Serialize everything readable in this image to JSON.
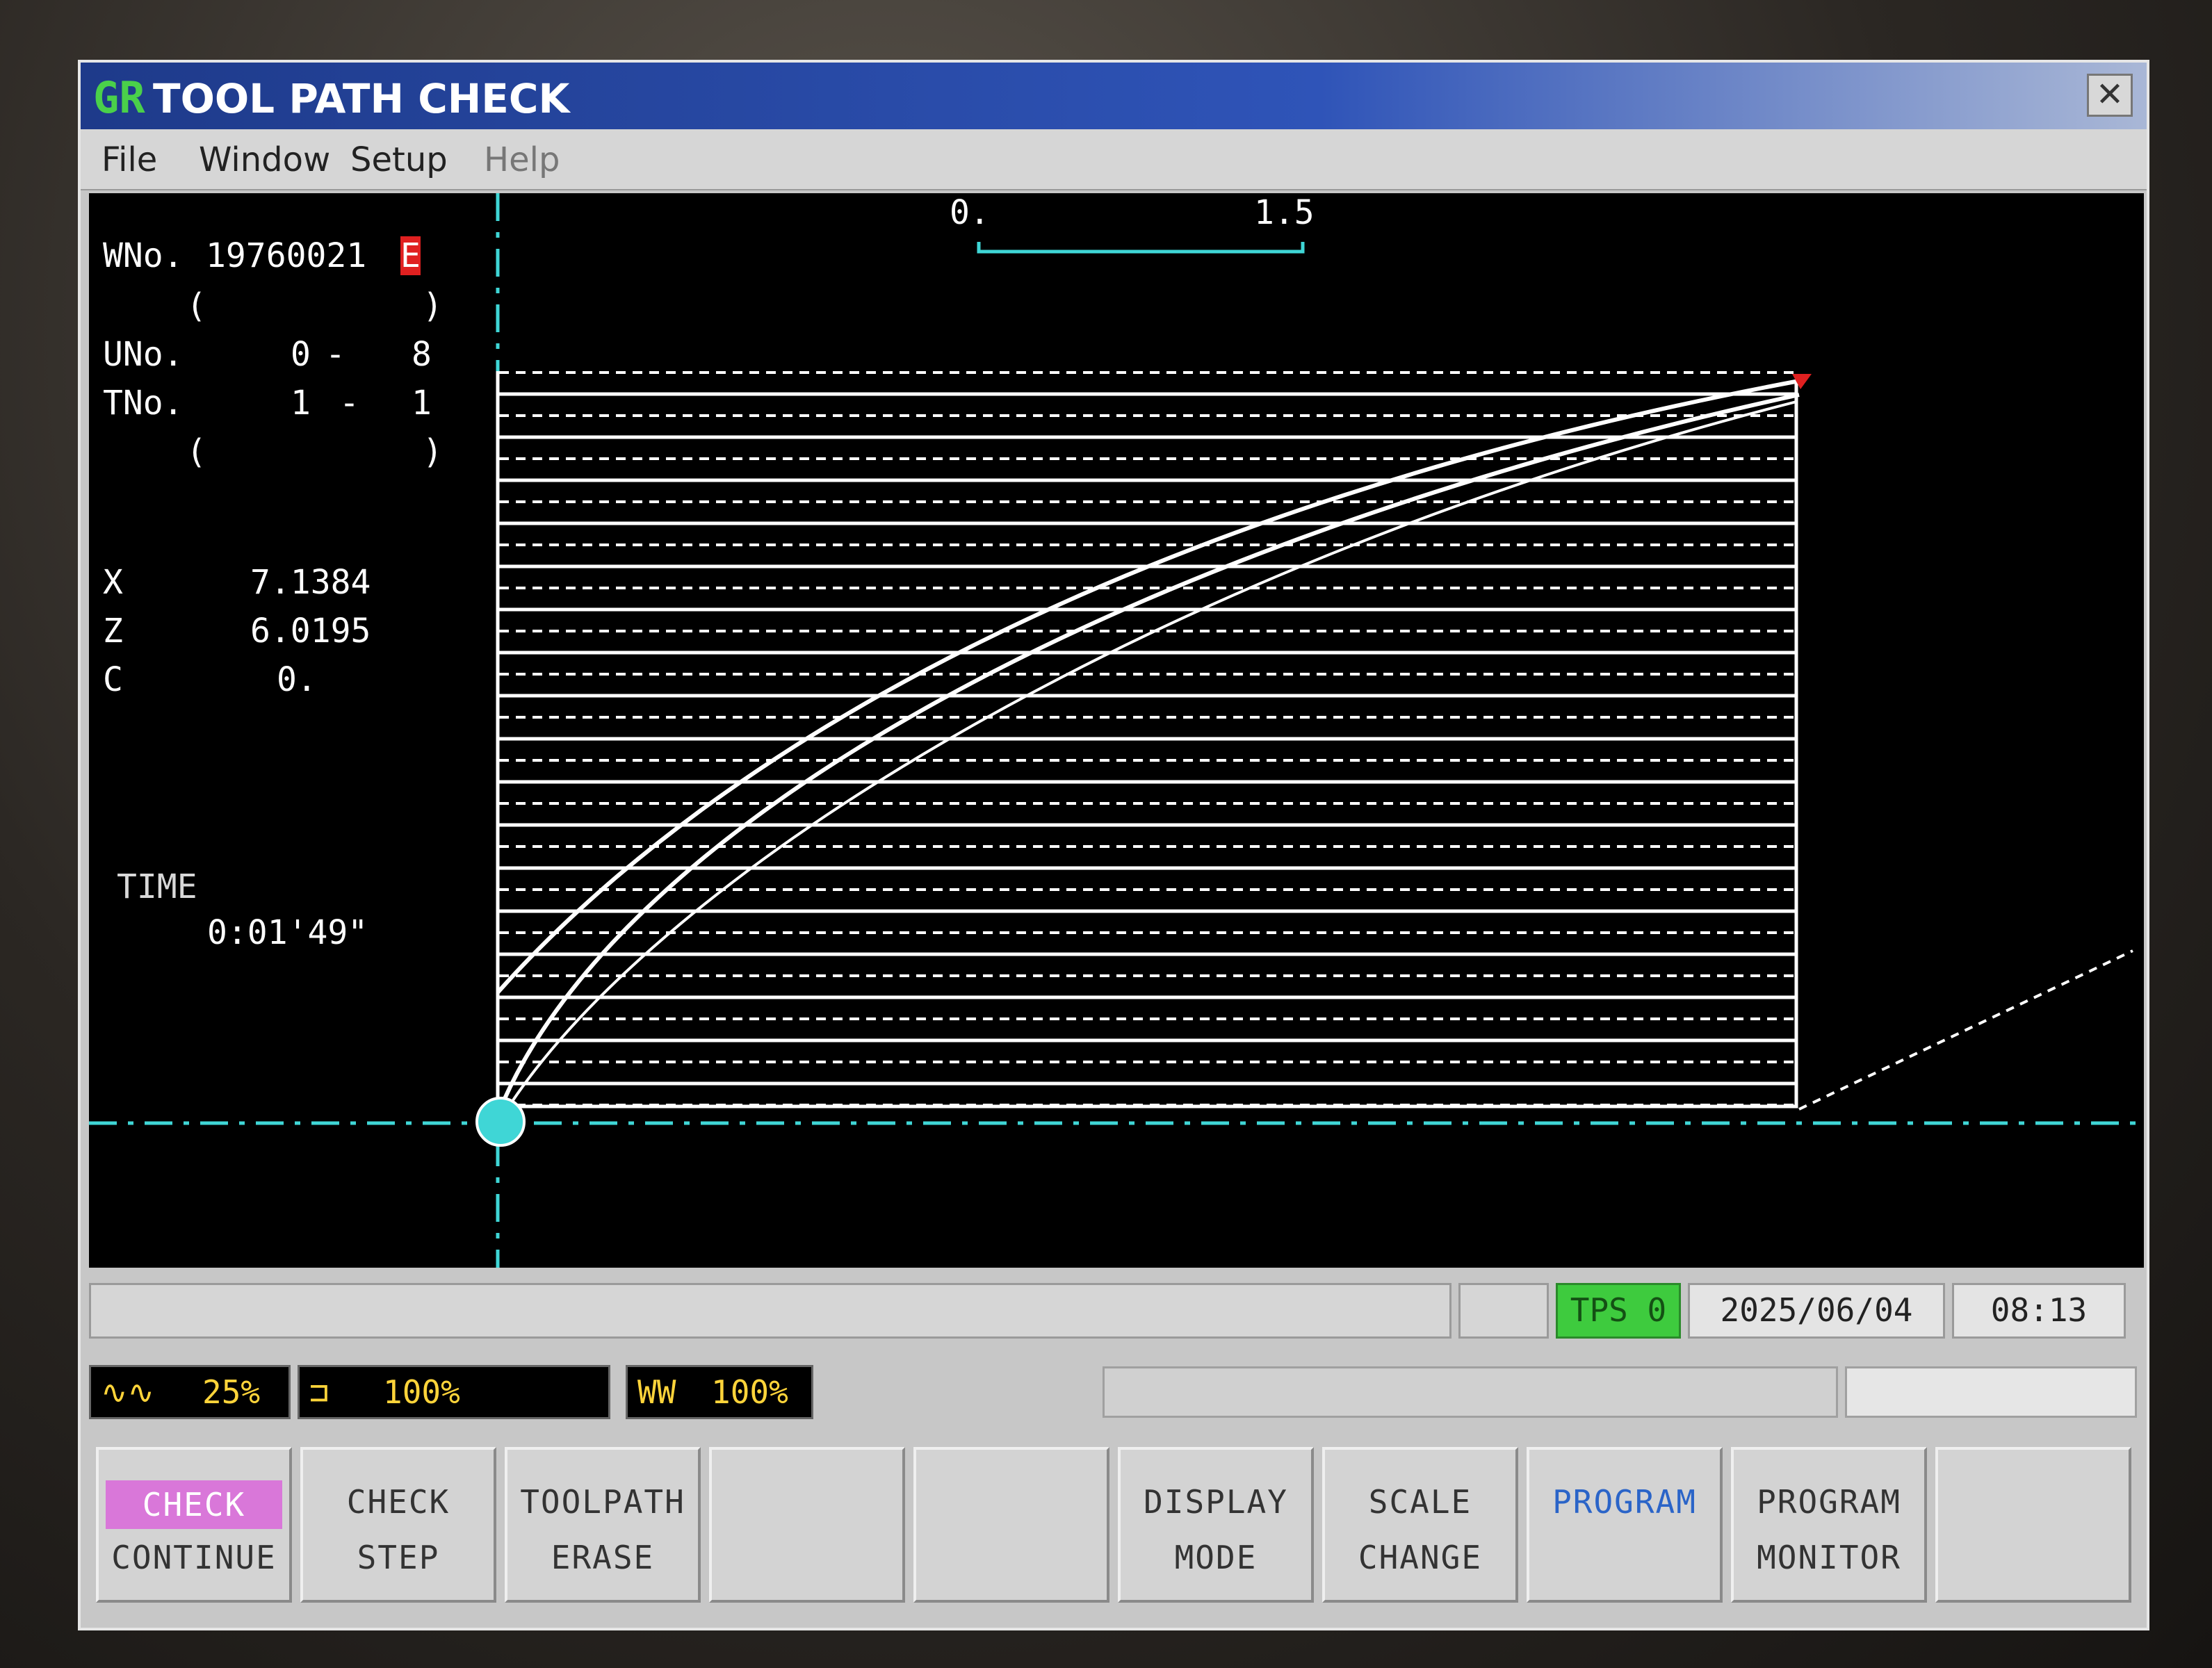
{
  "window": {
    "logo": "GR",
    "title": "TOOL PATH CHECK",
    "close_glyph": "✕",
    "menu": [
      "File",
      "Window",
      "Setup",
      "Help"
    ]
  },
  "info": {
    "wno_label": "WNo.",
    "wno_value": "19760021",
    "wno_suffix": "E",
    "paren1_open": "(",
    "paren1_close": ")",
    "uno_label": "UNo.",
    "uno_from": "0",
    "uno_sep": "-",
    "uno_to": "8",
    "tno_label": "TNo.",
    "tno_from": "1",
    "tno_sep": "-",
    "tno_to": "1",
    "paren2_open": "(",
    "paren2_close": ")",
    "x_label": "X",
    "x_value": "7.1384",
    "z_label": "Z",
    "z_value": "6.0195",
    "c_label": "C",
    "c_value": "0.",
    "time_label": "TIME",
    "time_value": "0:01'49\""
  },
  "scale": {
    "start": "0.",
    "end": "1.5"
  },
  "status": {
    "tps": "TPS 0",
    "date": "2025/06/04",
    "time": "08:13"
  },
  "overrides": [
    {
      "icon": "rapid-override-icon",
      "glyph": "∿∿",
      "value": "25%"
    },
    {
      "icon": "spindle-override-icon",
      "glyph": "⊐",
      "value": "100%"
    },
    {
      "icon": "feed-override-icon",
      "glyph": "WW",
      "value": "100%"
    }
  ],
  "softkeys": [
    {
      "l1": "CHECK",
      "l2": "CONTINUE"
    },
    {
      "l1": "CHECK",
      "l2": "STEP"
    },
    {
      "l1": "TOOLPATH",
      "l2": "ERASE"
    },
    {
      "l1": "",
      "l2": ""
    },
    {
      "l1": "",
      "l2": ""
    },
    {
      "l1": "DISPLAY",
      "l2": "MODE"
    },
    {
      "l1": "SCALE",
      "l2": "CHANGE"
    },
    {
      "l1": "PROGRAM",
      "l2": ""
    },
    {
      "l1": "PROGRAM",
      "l2": "MONITOR"
    },
    {
      "l1": "",
      "l2": ""
    }
  ],
  "colors": {
    "axis": "#3fd6d6",
    "path": "#ffffff",
    "active_key": "#d977d9",
    "tps": "#3ecb3e",
    "override_text": "#ffd43a"
  }
}
